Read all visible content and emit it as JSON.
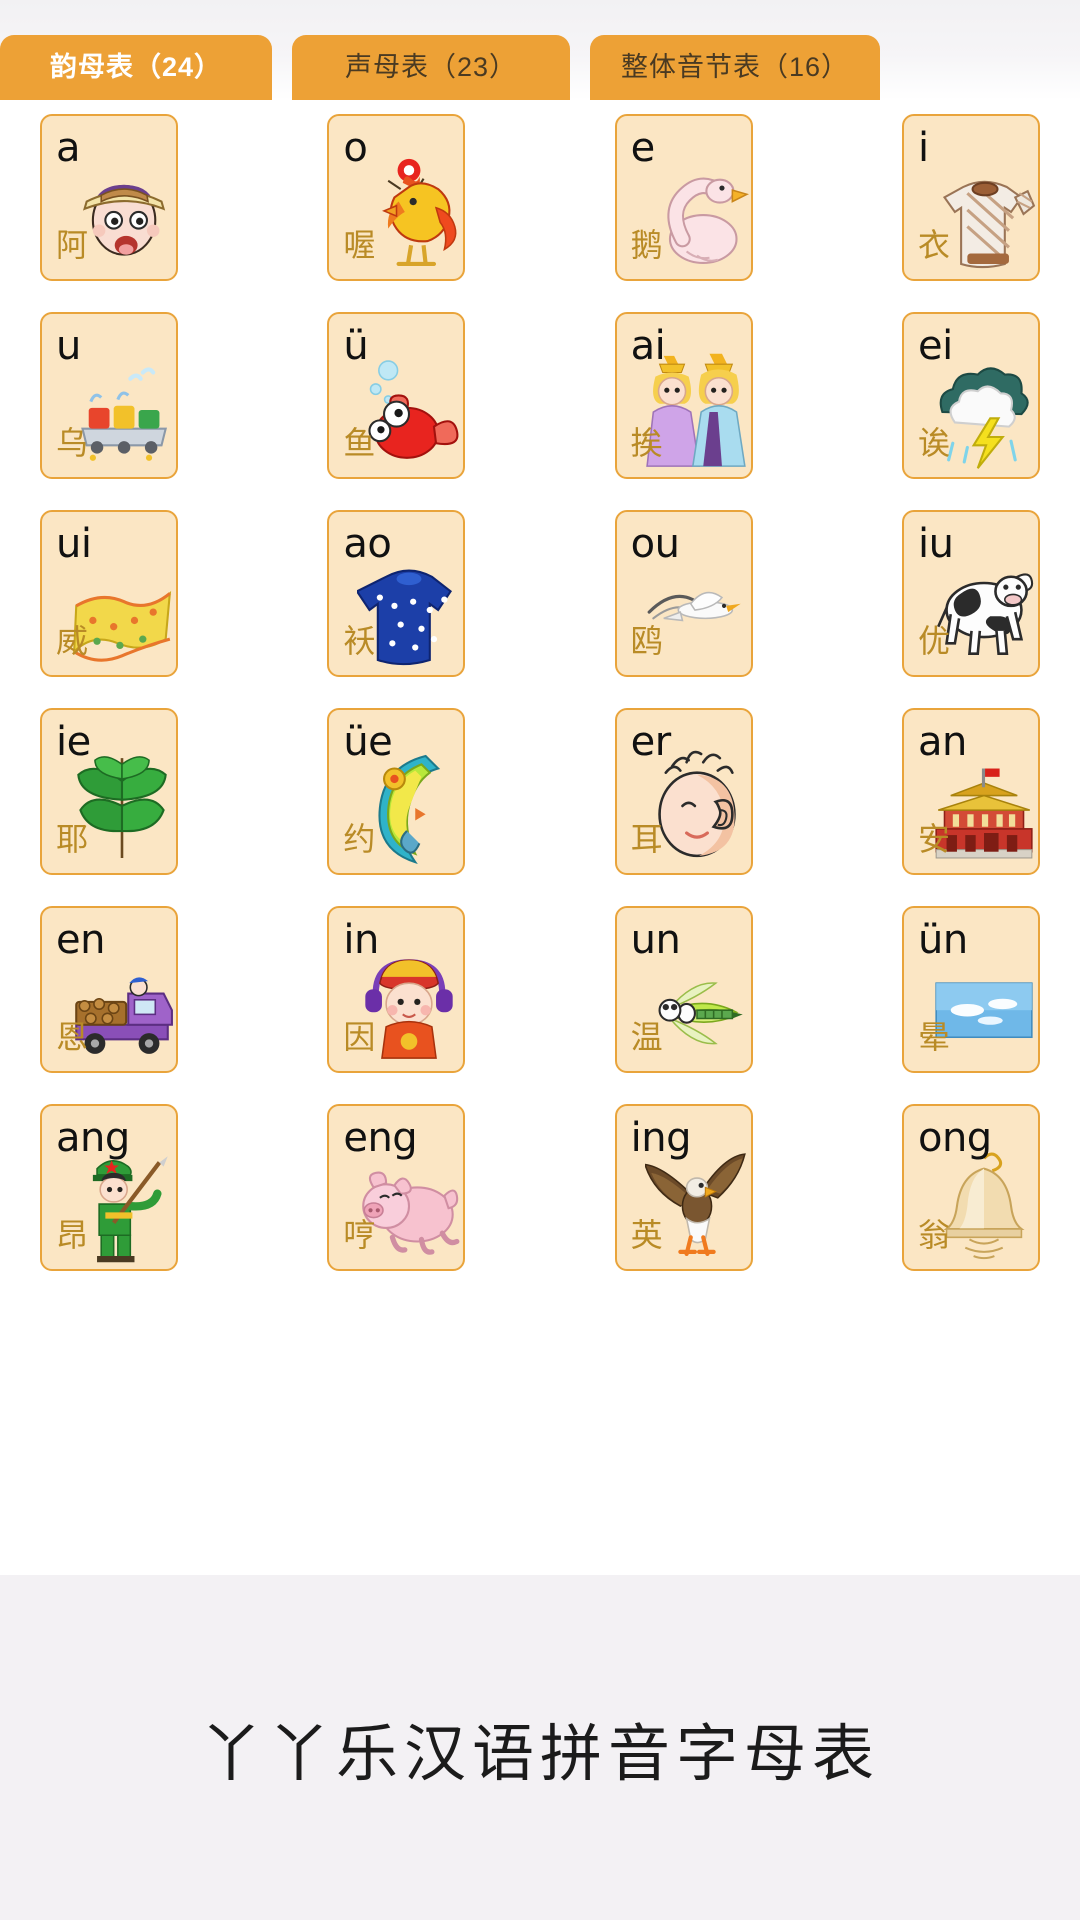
{
  "tabs": [
    {
      "label": "韵母表（24）",
      "active": true,
      "name": "tab-finals"
    },
    {
      "label": "声母表（23）",
      "active": false,
      "name": "tab-initials"
    },
    {
      "label": "整体音节表（16）",
      "active": false,
      "name": "tab-whole-syllables"
    }
  ],
  "colors": {
    "tab_bg": "#eda136",
    "tab_active_text": "#ffffff",
    "tab_text": "#4a3a22",
    "card_bg": "#fbe6c4",
    "card_border": "#e9a43b",
    "pinyin_text": "#111111",
    "hanzi_text": "#b98b26",
    "footer_bg": "#f3f1f4",
    "page_bg": "#ffffff"
  },
  "cards": [
    {
      "pinyin": "a",
      "hanzi": "阿",
      "art": "boy-face"
    },
    {
      "pinyin": "o",
      "hanzi": "喔",
      "art": "rooster"
    },
    {
      "pinyin": "e",
      "hanzi": "鹅",
      "art": "goose"
    },
    {
      "pinyin": "i",
      "hanzi": "衣",
      "art": "sweater"
    },
    {
      "pinyin": "u",
      "hanzi": "乌",
      "art": "toy-train"
    },
    {
      "pinyin": "ü",
      "hanzi": "鱼",
      "art": "red-fish"
    },
    {
      "pinyin": "ai",
      "hanzi": "挨",
      "art": "two-princesses"
    },
    {
      "pinyin": "ei",
      "hanzi": "诶",
      "art": "thunder-cloud"
    },
    {
      "pinyin": "ui",
      "hanzi": "威",
      "art": "yellow-blanket"
    },
    {
      "pinyin": "ao",
      "hanzi": "袄",
      "art": "blue-coat"
    },
    {
      "pinyin": "ou",
      "hanzi": "鸥",
      "art": "seagull"
    },
    {
      "pinyin": "iu",
      "hanzi": "优",
      "art": "dairy-cow"
    },
    {
      "pinyin": "ie",
      "hanzi": "耶",
      "art": "green-leaf"
    },
    {
      "pinyin": "üe",
      "hanzi": "约",
      "art": "crescent-moon"
    },
    {
      "pinyin": "er",
      "hanzi": "耳",
      "art": "ear-head"
    },
    {
      "pinyin": "an",
      "hanzi": "安",
      "art": "tiananmen"
    },
    {
      "pinyin": "en",
      "hanzi": "恩",
      "art": "truck-logs"
    },
    {
      "pinyin": "in",
      "hanzi": "因",
      "art": "girl-headphones"
    },
    {
      "pinyin": "un",
      "hanzi": "温",
      "art": "dragonfly"
    },
    {
      "pinyin": "ün",
      "hanzi": "晕",
      "art": "blue-sky"
    },
    {
      "pinyin": "ang",
      "hanzi": "昂",
      "art": "soldier-boy"
    },
    {
      "pinyin": "eng",
      "hanzi": "哼",
      "art": "pink-pig"
    },
    {
      "pinyin": "ing",
      "hanzi": "英",
      "art": "eagle"
    },
    {
      "pinyin": "ong",
      "hanzi": "翁",
      "art": "bell"
    }
  ],
  "footer": {
    "title": "丫丫乐汉语拼音字母表"
  }
}
